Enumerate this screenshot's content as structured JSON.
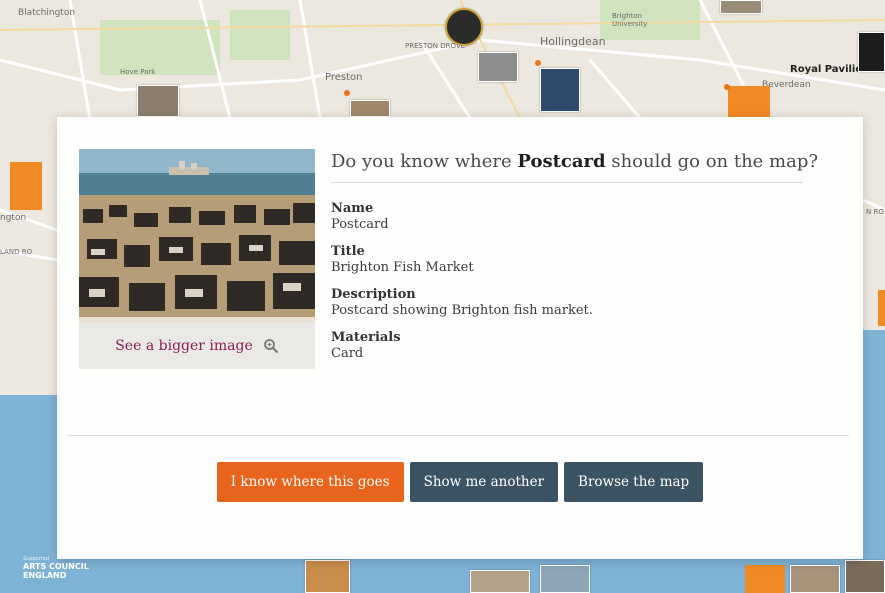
{
  "map": {
    "labels": [
      "Blatchington",
      "PRESTON DROVE",
      "Hollingdean",
      "Brighton University",
      "Hove Park",
      "Preston",
      "Royal Pavilion & M",
      "Beverdean",
      "ngton",
      "LAND RO",
      "N RO"
    ],
    "colors": {
      "park": "#cfe3bf",
      "sea": "#7fb3d6",
      "road": "#ffffff",
      "pin": "#f08a24"
    }
  },
  "modal": {
    "image_link": "See a bigger image",
    "question": {
      "prefix": "Do you know where ",
      "object": "Postcard",
      "suffix": " should go on the map?"
    },
    "fields": [
      {
        "label": "Name",
        "value": "Postcard"
      },
      {
        "label": "Title",
        "value": "Brighton Fish Market"
      },
      {
        "label": "Description",
        "value": "Postcard showing Brighton fish market."
      },
      {
        "label": "Materials",
        "value": "Card"
      }
    ],
    "buttons": {
      "know": "I know where this goes",
      "another": "Show me another",
      "browse": "Browse the map"
    },
    "colors": {
      "primary_button": "#e8641c",
      "secondary_button": "#3c5364",
      "link": "#8a1b55"
    }
  },
  "footer": {
    "supported": "Supported",
    "arts_line1": "ARTS COUNCIL",
    "arts_line2": "ENGLAND"
  }
}
